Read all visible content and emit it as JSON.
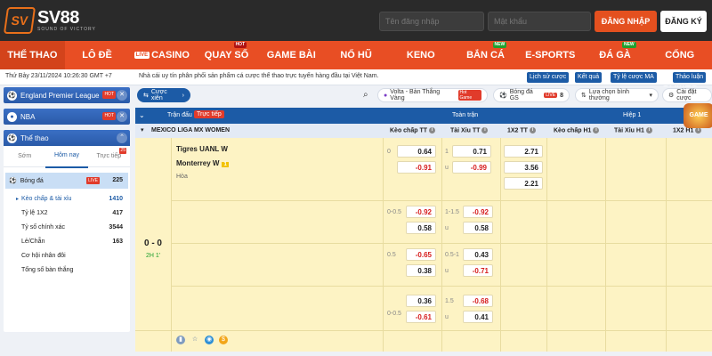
{
  "brand": {
    "badge": "SV",
    "name": "SV88",
    "tagline": "SOUND OF VICTORY",
    "accent": "#e84e24"
  },
  "login": {
    "username_placeholder": "Tên đăng nhập",
    "password_placeholder": "Mật khẩu",
    "login_label": "ĐĂNG NHẬP",
    "register_label": "ĐĂNG KÝ"
  },
  "nav": [
    {
      "label": "THỂ THAO",
      "active": true
    },
    {
      "label": "LÔ ĐỀ"
    },
    {
      "label": "CASINO",
      "live": "LIVE"
    },
    {
      "label": "QUAY SỐ",
      "badge": "HOT"
    },
    {
      "label": "GAME BÀI"
    },
    {
      "label": "NỔ HŨ"
    },
    {
      "label": "KENO"
    },
    {
      "label": "BẮN CÁ",
      "badge": "NEW"
    },
    {
      "label": "E-SPORTS"
    },
    {
      "label": "ĐÁ GÀ",
      "badge": "NEW"
    },
    {
      "label": "CỔNG GAMES"
    }
  ],
  "topbar": {
    "datetime": "Thứ Bảy 23/11/2024 10:26:30 GMT +7",
    "notice": "Nhà cái uy tín phân phối sản phẩm cá cược thể thao trực tuyến hàng đầu tại Việt Nam.",
    "buttons": [
      "Lịch sử cược",
      "Kết quả",
      "Tỷ lệ cược MA",
      "Thảo luận"
    ]
  },
  "sidebar": {
    "leagues": [
      {
        "label": "England Premier League",
        "tag": "HOT"
      },
      {
        "label": "NBA",
        "tag": "HOT"
      }
    ],
    "sports_title": "Thể thao",
    "tabs": [
      {
        "label": "Sớm"
      },
      {
        "label": "Hôm nay",
        "active": true
      },
      {
        "label": "Trực tiếp",
        "count": "25"
      }
    ],
    "sport": {
      "label": "Bóng đá",
      "live": "LIVE",
      "count": "225"
    },
    "markets": [
      {
        "label": "Kèo chấp & tài xỉu",
        "count": "1410",
        "selected": true
      },
      {
        "label": "Tỷ lệ 1X2",
        "count": "417"
      },
      {
        "label": "Tỷ số chính xác",
        "count": "3544"
      },
      {
        "label": "Lẻ/Chẵn",
        "count": "163"
      },
      {
        "label": "Cơ hội nhân đôi",
        "count": ""
      },
      {
        "label": "Tổng số bàn thắng",
        "count": ""
      }
    ]
  },
  "filters": {
    "parlay": "Cược xiên",
    "volta": "Volta - Bàn Thắng Vàng",
    "volta_tag": "Hot Game",
    "bongda": "Bóng đá GS",
    "bongda_live": "LIVE",
    "bongda_count": "8",
    "sort": "Lựa chọn bình thường",
    "settings": "Cài đặt cược"
  },
  "table": {
    "header": {
      "match": "Trận đấu",
      "live_tag": "Trực tiếp",
      "full": "Toàn trận",
      "half": "Hiệp 1"
    },
    "league": "MEXICO LIGA MX WOMEN",
    "cols": [
      "Kèo chấp TT",
      "Tài Xỉu TT",
      "1X2 TT",
      "Kèo chấp H1",
      "Tài Xỉu H1",
      "1X2 H1"
    ],
    "home": "Tigres UANL W",
    "away": "Monterrey W",
    "away_badge": "1",
    "draw": "Hòa",
    "score": "0 - 0",
    "period": "2H 1'",
    "rows": [
      {
        "hdp_label": "0",
        "hdp_home": "0.64",
        "hdp_away": "-0.91",
        "ou_label": "1",
        "ou_label2": "u",
        "ou_over": "0.71",
        "ou_under": "-0.99",
        "x12": [
          "2.71",
          "3.56",
          "2.21"
        ]
      },
      {
        "hdp_label": "0-0.5",
        "hdp_home": "-0.92",
        "hdp_away": "0.58",
        "ou_label": "1-1.5",
        "ou_label2": "u",
        "ou_over": "-0.92",
        "ou_under": "0.58"
      },
      {
        "hdp_label": "0.5",
        "hdp_home": "-0.65",
        "hdp_away": "0.38",
        "ou_label": "0.5-1",
        "ou_label2": "u",
        "ou_over": "0.43",
        "ou_under": "-0.71"
      },
      {
        "hdp_label": "0-0.5",
        "hdp_home": "0.36",
        "hdp_away": "-0.61",
        "ou_label": "1.5",
        "ou_label2": "u",
        "ou_over": "-0.68",
        "ou_under": "0.41"
      }
    ]
  },
  "promo": "GAME"
}
